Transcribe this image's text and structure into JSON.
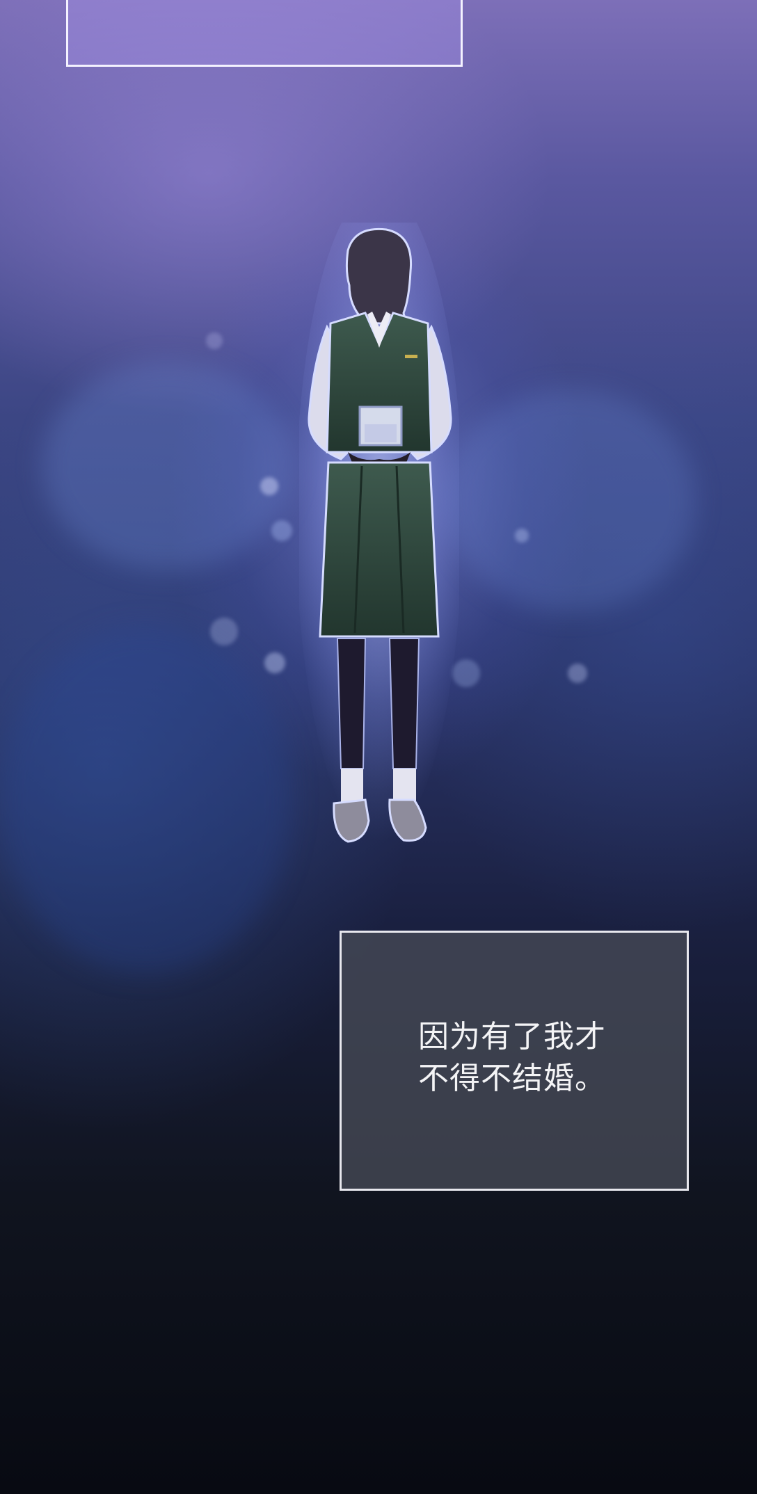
{
  "caption_top": {
    "text": ""
  },
  "caption": {
    "line1": "因为有了我才",
    "line2": "不得不结婚。"
  }
}
